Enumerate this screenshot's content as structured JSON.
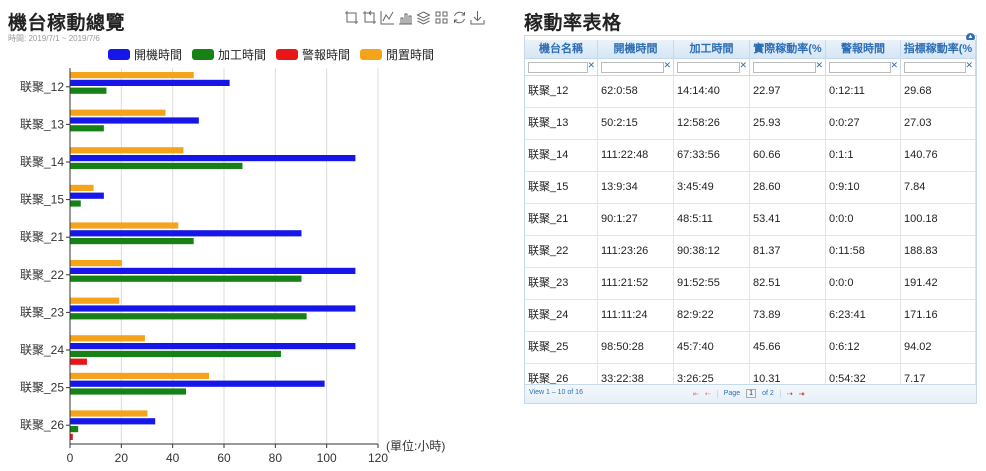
{
  "left": {
    "title": "機台稼動總覽",
    "subtitle": "時間: 2019/7/1 ~ 2019/7/6",
    "toolbox_icons": [
      "zoom-icon",
      "zoom-reset-icon",
      "line-chart-icon",
      "bar-chart-icon",
      "stack-icon",
      "tiled-icon",
      "restore-icon",
      "download-icon"
    ]
  },
  "chart_data": {
    "type": "bar",
    "orientation": "horizontal",
    "categories": [
      "联聚_12",
      "联聚_13",
      "联聚_14",
      "联聚_15",
      "联聚_21",
      "联聚_22",
      "联聚_23",
      "联聚_24",
      "联聚_25",
      "联聚_26"
    ],
    "series": [
      {
        "name": "開機時間",
        "color": "#1616e8",
        "values": [
          62.0,
          50.0,
          111.0,
          13.0,
          90.0,
          111.0,
          111.0,
          111.0,
          99.0,
          33.0
        ]
      },
      {
        "name": "加工時間",
        "color": "#168216",
        "values": [
          14.0,
          13.0,
          67.0,
          4.0,
          48.0,
          90.0,
          92.0,
          82.0,
          45.0,
          3.0
        ]
      },
      {
        "name": "警報時間",
        "color": "#e81616",
        "values": [
          0.0,
          0.0,
          0.0,
          0.0,
          0.0,
          0.0,
          0.0,
          6.4,
          0.0,
          0.9
        ]
      },
      {
        "name": "閒置時間",
        "color": "#f5a31a",
        "values": [
          48.0,
          37.0,
          44.0,
          9.0,
          42.0,
          20.0,
          19.0,
          29.0,
          54.0,
          30.0
        ]
      }
    ],
    "xlim": [
      0,
      120
    ],
    "xticks": [
      0,
      20,
      40,
      60,
      80,
      100,
      120
    ],
    "xlabel": "(單位:小時)",
    "legend_position": "top",
    "grid": true
  },
  "right": {
    "title": "稼動率表格",
    "columns": [
      "機台名稱",
      "開機時間",
      "加工時間",
      "實際稼動率(%",
      "警報時間",
      "指標稼動率(%"
    ],
    "rows": [
      [
        "联聚_12",
        "62:0:58",
        "14:14:40",
        "22.97",
        "0:12:11",
        "29.68"
      ],
      [
        "联聚_13",
        "50:2:15",
        "12:58:26",
        "25.93",
        "0:0:27",
        "27.03"
      ],
      [
        "联聚_14",
        "111:22:48",
        "67:33:56",
        "60.66",
        "0:1:1",
        "140.76"
      ],
      [
        "联聚_15",
        "13:9:34",
        "3:45:49",
        "28.60",
        "0:9:10",
        "7.84"
      ],
      [
        "联聚_21",
        "90:1:27",
        "48:5:11",
        "53.41",
        "0:0:0",
        "100.18"
      ],
      [
        "联聚_22",
        "111:23:26",
        "90:38:12",
        "81.37",
        "0:11:58",
        "188.83"
      ],
      [
        "联聚_23",
        "111:21:52",
        "91:52:55",
        "82.51",
        "0:0:0",
        "191.42"
      ],
      [
        "联聚_24",
        "111:11:24",
        "82:9:22",
        "73.89",
        "6:23:41",
        "171.16"
      ],
      [
        "联聚_25",
        "98:50:28",
        "45:7:40",
        "45.66",
        "0:6:12",
        "94.02"
      ],
      [
        "联聚_26",
        "33:22:38",
        "3:26:25",
        "10.31",
        "0:54:32",
        "7.17"
      ]
    ],
    "pager": {
      "view_text": "View 1 – 10 of 16",
      "page_label": "Page",
      "page_value": "1",
      "of_label": "of 2"
    }
  }
}
